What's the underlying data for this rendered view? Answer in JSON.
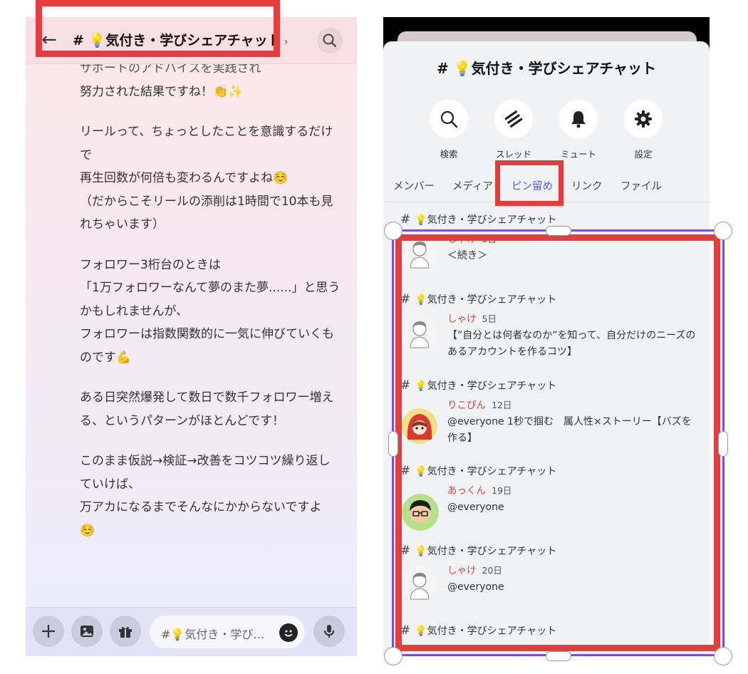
{
  "left_panel": {
    "back_label": "←",
    "channel_title": "# 💡気付き・学びシェアチャット",
    "chevron": "›",
    "messages": [
      "努力された結果ですね！👏✨",
      "リールって、ちょっとしたことを意識するだけ\nで\n再生回数が何倍も変わるんですよね☺️\n（だからこそリールの添削は1時間で10本も見\nれちゃいます）",
      "フォロワー3桁台のときは\n「1万フォロワーなんて夢のまた夢......」と思う\nかもしれませんが、\nフォロワーは指数関数的に一気に伸びていくも\nのです💪",
      "ある日突然爆発して数日で数千フォロワー増え\nる、というパターンがほとんどです！",
      "このまま仮説→検証→改善をコツコツ繰り返し\nていけば、\n万アカになるまでそんなにかからないですよ\n☺️"
    ],
    "partial_top_line": "サポートのアドバイスを実践され",
    "composer": {
      "placeholder": "#💡気付き・学び…"
    }
  },
  "right_panel": {
    "sheet_title": "# 💡気付き・学びシェアチャット",
    "actions": [
      {
        "label": "検索",
        "icon": "search-icon"
      },
      {
        "label": "スレッド",
        "icon": "threads-icon"
      },
      {
        "label": "ミュート",
        "icon": "bell-icon"
      },
      {
        "label": "設定",
        "icon": "gear-icon"
      }
    ],
    "tabs": [
      {
        "label": "メンバー",
        "active": false
      },
      {
        "label": "メディア",
        "active": false
      },
      {
        "label": "ピン留め",
        "active": true
      },
      {
        "label": "リンク",
        "active": false
      },
      {
        "label": "ファイル",
        "active": false
      }
    ],
    "pins": [
      {
        "channel": "💡気付き・学びシェアチャット",
        "author": "しゃけ",
        "date": "5日",
        "text": "＜続き＞",
        "avatar": "sketch"
      },
      {
        "channel": "💡気付き・学びシェアチャット",
        "author": "しゃけ",
        "date": "5日",
        "text": "【”自分とは何者なのか”を知って、自分だけのニーズのあるアカウントを作るコツ】",
        "avatar": "sketch"
      },
      {
        "channel": "💡気付き・学びシェアチャット",
        "author": "りこぴん",
        "date": "12日",
        "text": "@everyone 1秒で掴む　属人性×ストーリー【バズを作る】",
        "avatar": "red-hood"
      },
      {
        "channel": "💡気付き・学びシェアチャット",
        "author": "あっくん",
        "date": "19日",
        "text": "@everyone",
        "avatar": "glasses"
      },
      {
        "channel": "💡気付き・学びシェアチャット",
        "author": "しゃけ",
        "date": "20日",
        "text": "@everyone",
        "avatar": "sketch"
      },
      {
        "channel": "💡気付き・学びシェアチャット",
        "author": "",
        "date": "",
        "text": "",
        "avatar": ""
      }
    ]
  },
  "colors": {
    "highlight": "#e73c3c",
    "selection": "#7b4fe0",
    "active_tab": "#4a5ef0",
    "author_name": "#e2403f"
  }
}
